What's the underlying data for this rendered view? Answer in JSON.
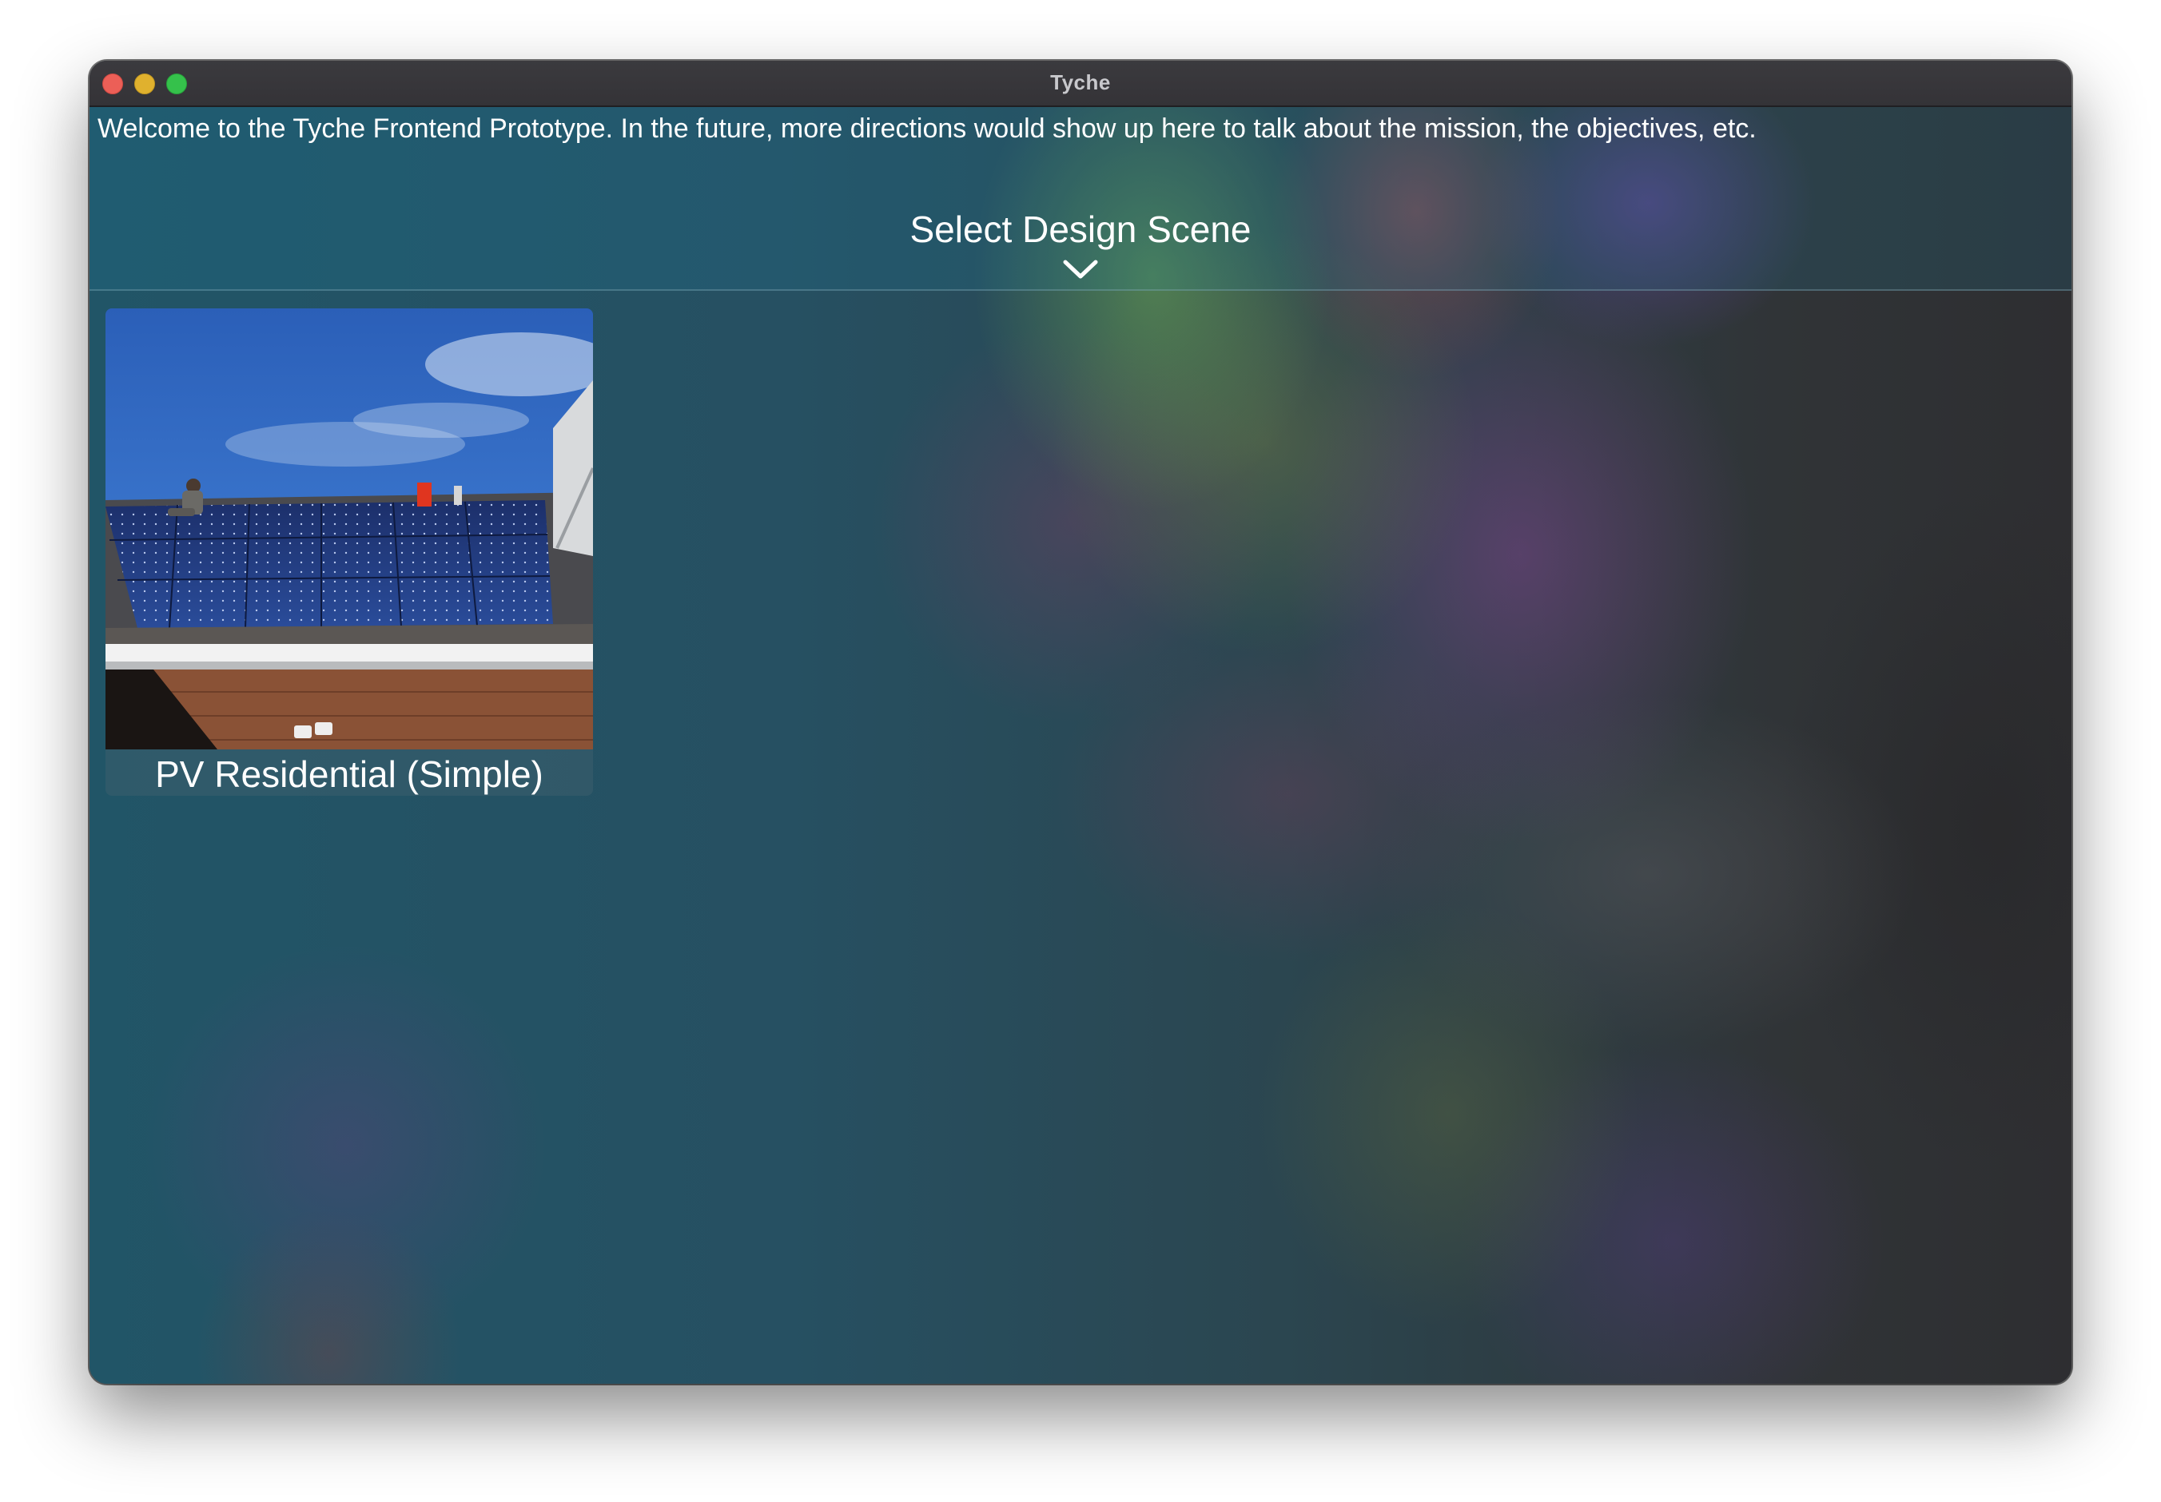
{
  "window": {
    "title": "Tyche"
  },
  "intro": {
    "welcome_text": "Welcome to the Tyche Frontend Prototype. In the future, more directions would show up here to talk about the mission, the objectives, etc."
  },
  "scene_selector": {
    "title": "Select Design Scene",
    "toggle_icon": "chevron-down-icon"
  },
  "scenes": [
    {
      "label": "PV Residential (Simple)",
      "image": "solar-panels-on-roof-photo"
    }
  ],
  "colors": {
    "close": "#ec5f57",
    "minimize": "#e0b12e",
    "maximize": "#35c14b",
    "titlebar": "#3b3a3e"
  }
}
